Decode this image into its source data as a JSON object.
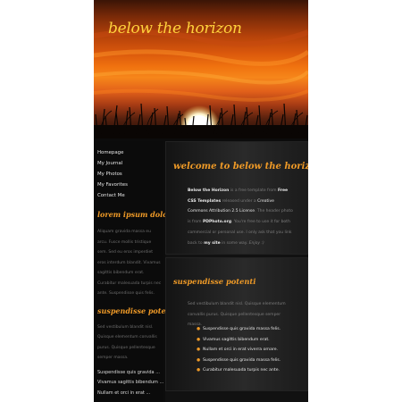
{
  "site": {
    "title": "below the horizon"
  },
  "nav": {
    "items": [
      "Homepage",
      "My Journal",
      "My Photos",
      "My Favorites",
      "Contact Me"
    ]
  },
  "sidebar": {
    "section1": {
      "heading": "lorem ipsum dolore",
      "text": "Aliquam gravida massa eu arcu. Fusce mollis tristique sem. Sed eu eros imperdiet eros interdum blandit. Vivamus sagittis bibendum erat. Curabitur malesuada turpis nec ante. Suspendisse quis felis."
    },
    "section2": {
      "heading": "suspendisse potenti",
      "text": "Sed vestibulum blandit nisl. Quisque elementum convallis purus. Quisque pellentesque semper massa.",
      "links": [
        "Suspendisse quis gravida ...",
        "Vivamus sagittis bibendum ...",
        "Nullam et orci in erat ..."
      ]
    }
  },
  "main": {
    "welcome": {
      "heading": "welcome to below the horizon!",
      "t1": "Below the Horizon",
      "t2": " is a free template from ",
      "t3": "Free CSS Templates",
      "t4": " released under a ",
      "t5": "Creative Commons Attribution 2.5 License",
      "t6": ". The header photo is from ",
      "t7": "PDPhoto.org",
      "t8": ". You're free to use it for both commercial or personal use. I only ask that you link back to ",
      "t9": "my site",
      "t10": " in some way. ",
      "t11": "Enjoy :)"
    },
    "section": {
      "heading": "suspendisse potenti",
      "text": "Sed vestibulum blandit nisl. Quisque elementum convallis purus. Quisque pellentesque semper massa.",
      "list": [
        "Suspendisse quis gravida massa felis.",
        "Vivamus sagittis bibendum erat.",
        "Nullam et orci in erat viverra ornare.",
        "Suspendisse quis gravida massa felis.",
        "Curabitur malesuada turpis nec ante."
      ]
    }
  },
  "colors": {
    "accent": "#ef9a27",
    "title": "#ffd23c",
    "background": "#0c0c0c"
  }
}
